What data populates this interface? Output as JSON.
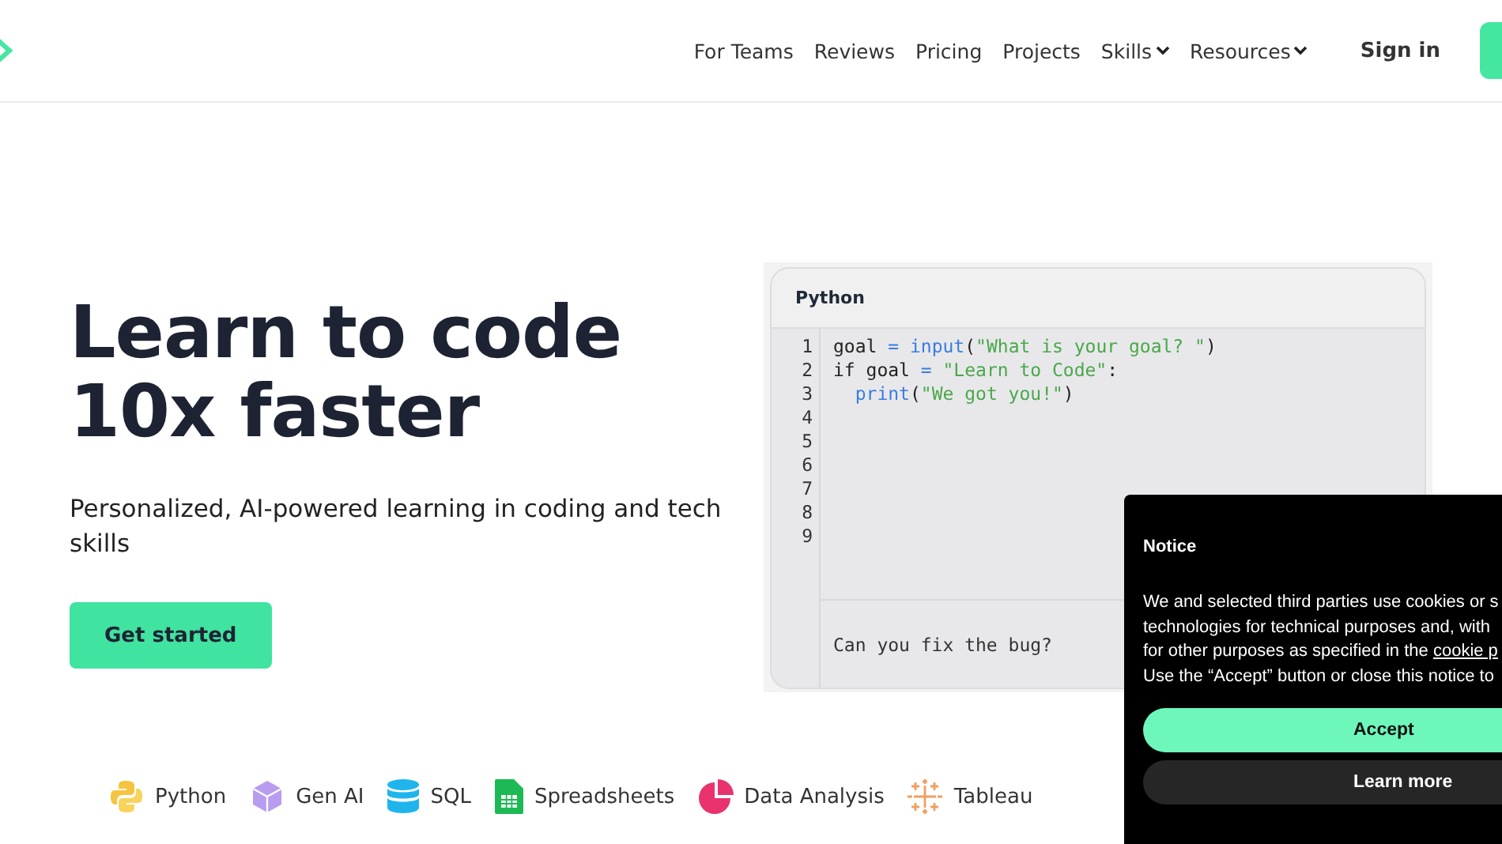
{
  "nav": {
    "links": [
      {
        "label": "For Teams",
        "dropdown": false
      },
      {
        "label": "Reviews",
        "dropdown": false
      },
      {
        "label": "Pricing",
        "dropdown": false
      },
      {
        "label": "Projects",
        "dropdown": false
      },
      {
        "label": "Skills",
        "dropdown": true
      },
      {
        "label": "Resources",
        "dropdown": true
      }
    ],
    "sign_in": "Sign in"
  },
  "hero": {
    "title_lines": [
      "Learn to code",
      "10x faster"
    ],
    "subtitle": "Personalized, AI-powered learning in coding and tech skills",
    "cta": "Get started"
  },
  "code_card": {
    "language": "Python",
    "lines": [
      {
        "number": "1",
        "tokens": [
          {
            "text": "goal ",
            "kind": "plain"
          },
          {
            "text": "=",
            "kind": "keyword"
          },
          {
            "text": " input",
            "kind": "keyword"
          },
          {
            "text": "(",
            "kind": "plain"
          },
          {
            "text": "\"What is your goal? \"",
            "kind": "string"
          },
          {
            "text": ")",
            "kind": "plain"
          }
        ]
      },
      {
        "number": "2",
        "tokens": [
          {
            "text": "if goal ",
            "kind": "plain"
          },
          {
            "text": "=",
            "kind": "keyword"
          },
          {
            "text": " \"Learn to Code\"",
            "kind": "string"
          },
          {
            "text": ":",
            "kind": "plain"
          }
        ]
      },
      {
        "number": "3",
        "indent": true,
        "tokens": [
          {
            "text": "print",
            "kind": "keyword"
          },
          {
            "text": "(",
            "kind": "plain"
          },
          {
            "text": "\"We got you!\"",
            "kind": "string"
          },
          {
            "text": ")",
            "kind": "plain"
          }
        ]
      },
      {
        "number": "4"
      },
      {
        "number": "5"
      },
      {
        "number": "6"
      },
      {
        "number": "7"
      },
      {
        "number": "8"
      },
      {
        "number": "9"
      }
    ],
    "prompt": "Can you fix the bug?"
  },
  "skills": [
    {
      "label": "Python",
      "kind": "python"
    },
    {
      "label": "Gen AI",
      "kind": "cube"
    },
    {
      "label": "SQL",
      "kind": "database"
    },
    {
      "label": "Spreadsheets",
      "kind": "sheet"
    },
    {
      "label": "Data Analysis",
      "kind": "pie"
    },
    {
      "label": "Tableau",
      "kind": "crosses"
    }
  ],
  "cookie_notice": {
    "title": "Notice",
    "lines": [
      {
        "text": "We and selected third parties use cookies or s"
      },
      {
        "text": "technologies for technical purposes and, with"
      },
      {
        "text": "for other purposes as specified in the ",
        "link": "cookie p"
      },
      {
        "text": "Use the “Accept” button or close this notice to"
      }
    ],
    "accept": "Accept",
    "learn_more": "Learn more"
  }
}
